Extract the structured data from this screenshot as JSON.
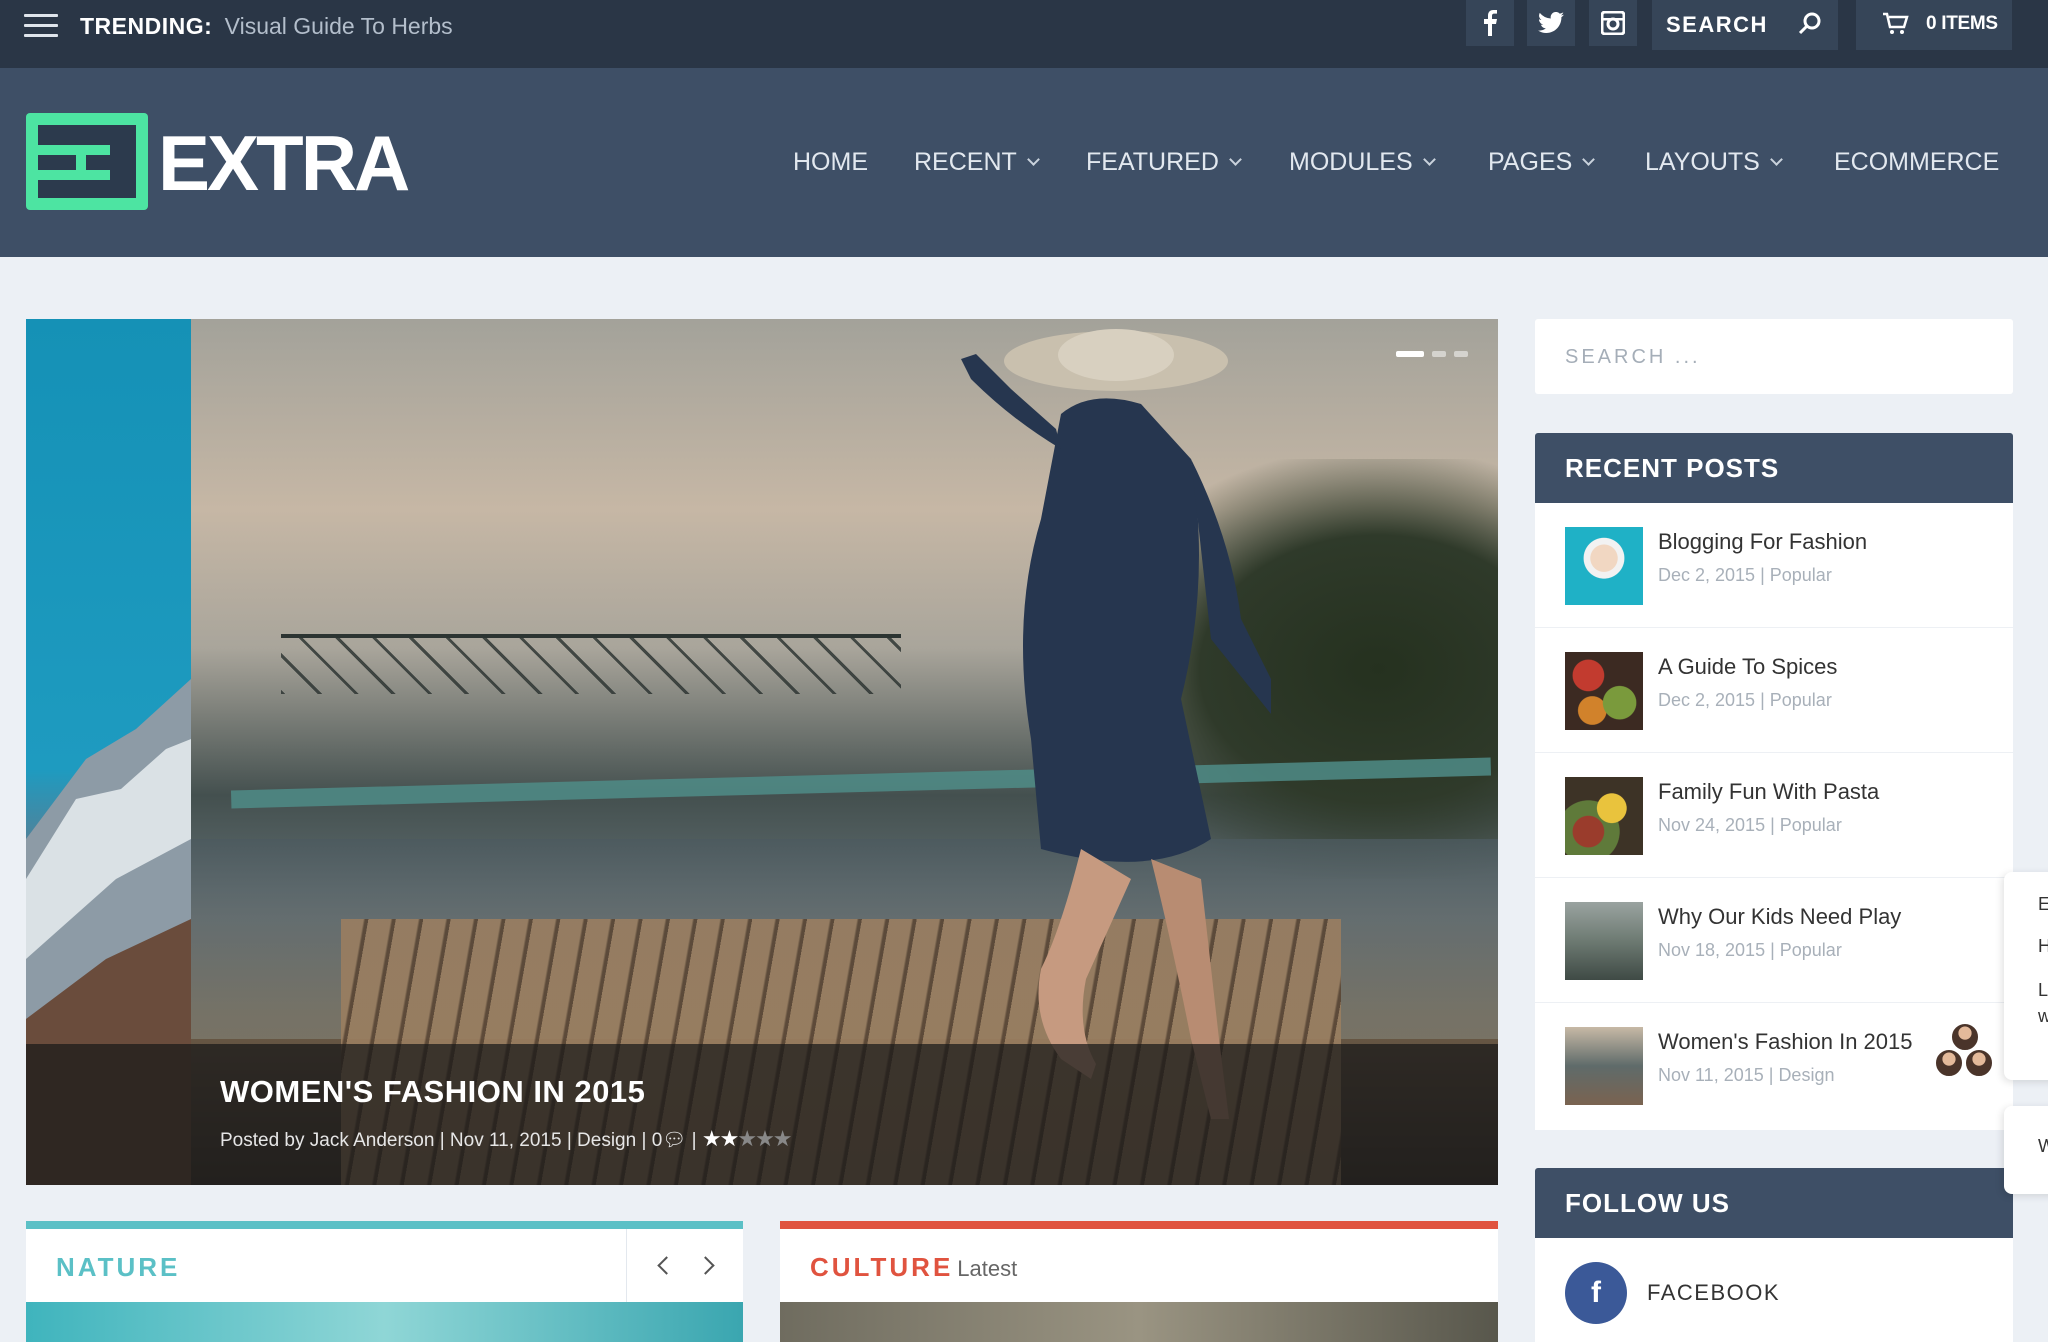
{
  "topbar": {
    "trending_label": "TRENDING:",
    "trending_link": "Visual Guide To Herbs",
    "social": [
      "facebook-icon",
      "twitter-icon",
      "instagram-icon"
    ],
    "search_label": "SEARCH",
    "cart_label": "0 ITEMS"
  },
  "header": {
    "logo_text": "EXTRA",
    "nav": [
      {
        "label": "HOME",
        "dropdown": false
      },
      {
        "label": "RECENT",
        "dropdown": true
      },
      {
        "label": "FEATURED",
        "dropdown": true
      },
      {
        "label": "MODULES",
        "dropdown": true
      },
      {
        "label": "PAGES",
        "dropdown": true
      },
      {
        "label": "LAYOUTS",
        "dropdown": true
      },
      {
        "label": "ECOMMERCE",
        "dropdown": false
      }
    ]
  },
  "slider": {
    "title": "WOMEN'S FASHION IN 2015",
    "meta": {
      "posted_by_prefix": "Posted by",
      "author": "Jack Anderson",
      "date": "Nov 11, 2015",
      "category": "Design",
      "comments": "0",
      "rating_stars": 2.5
    },
    "dots": 3,
    "active_dot": 0
  },
  "modules": [
    {
      "title": "NATURE",
      "subtitle": "",
      "color": "#5bc0c6"
    },
    {
      "title": "CULTURE",
      "subtitle": "Latest",
      "color": "#e0533f"
    }
  ],
  "sidebar": {
    "search_placeholder": "SEARCH ...",
    "recent_posts_title": "RECENT POSTS",
    "recent_posts": [
      {
        "title": "Blogging For Fashion",
        "date": "Dec 2, 2015",
        "category": "Popular"
      },
      {
        "title": "A Guide To Spices",
        "date": "Dec 2, 2015",
        "category": "Popular"
      },
      {
        "title": "Family Fun With Pasta",
        "date": "Nov 24, 2015",
        "category": "Popular"
      },
      {
        "title": "Why Our Kids Need Play",
        "date": "Nov 18, 2015",
        "category": "Popular"
      },
      {
        "title": "Women's Fashion In 2015",
        "date": "Nov 11, 2015",
        "category": "Design"
      }
    ],
    "follow_title": "FOLLOW US",
    "follow": [
      {
        "network": "FACEBOOK",
        "icon": "facebook-icon"
      }
    ]
  },
  "edge_panels": {
    "upper": [
      "E",
      "H",
      "L",
      "w"
    ],
    "lower": [
      "W"
    ]
  },
  "colors": {
    "topbar": "#2a3646",
    "header": "#3e4f66",
    "accent_green": "#4de4a2",
    "nature": "#5bc0c6",
    "culture": "#e0533f",
    "facebook": "#3b5998"
  }
}
